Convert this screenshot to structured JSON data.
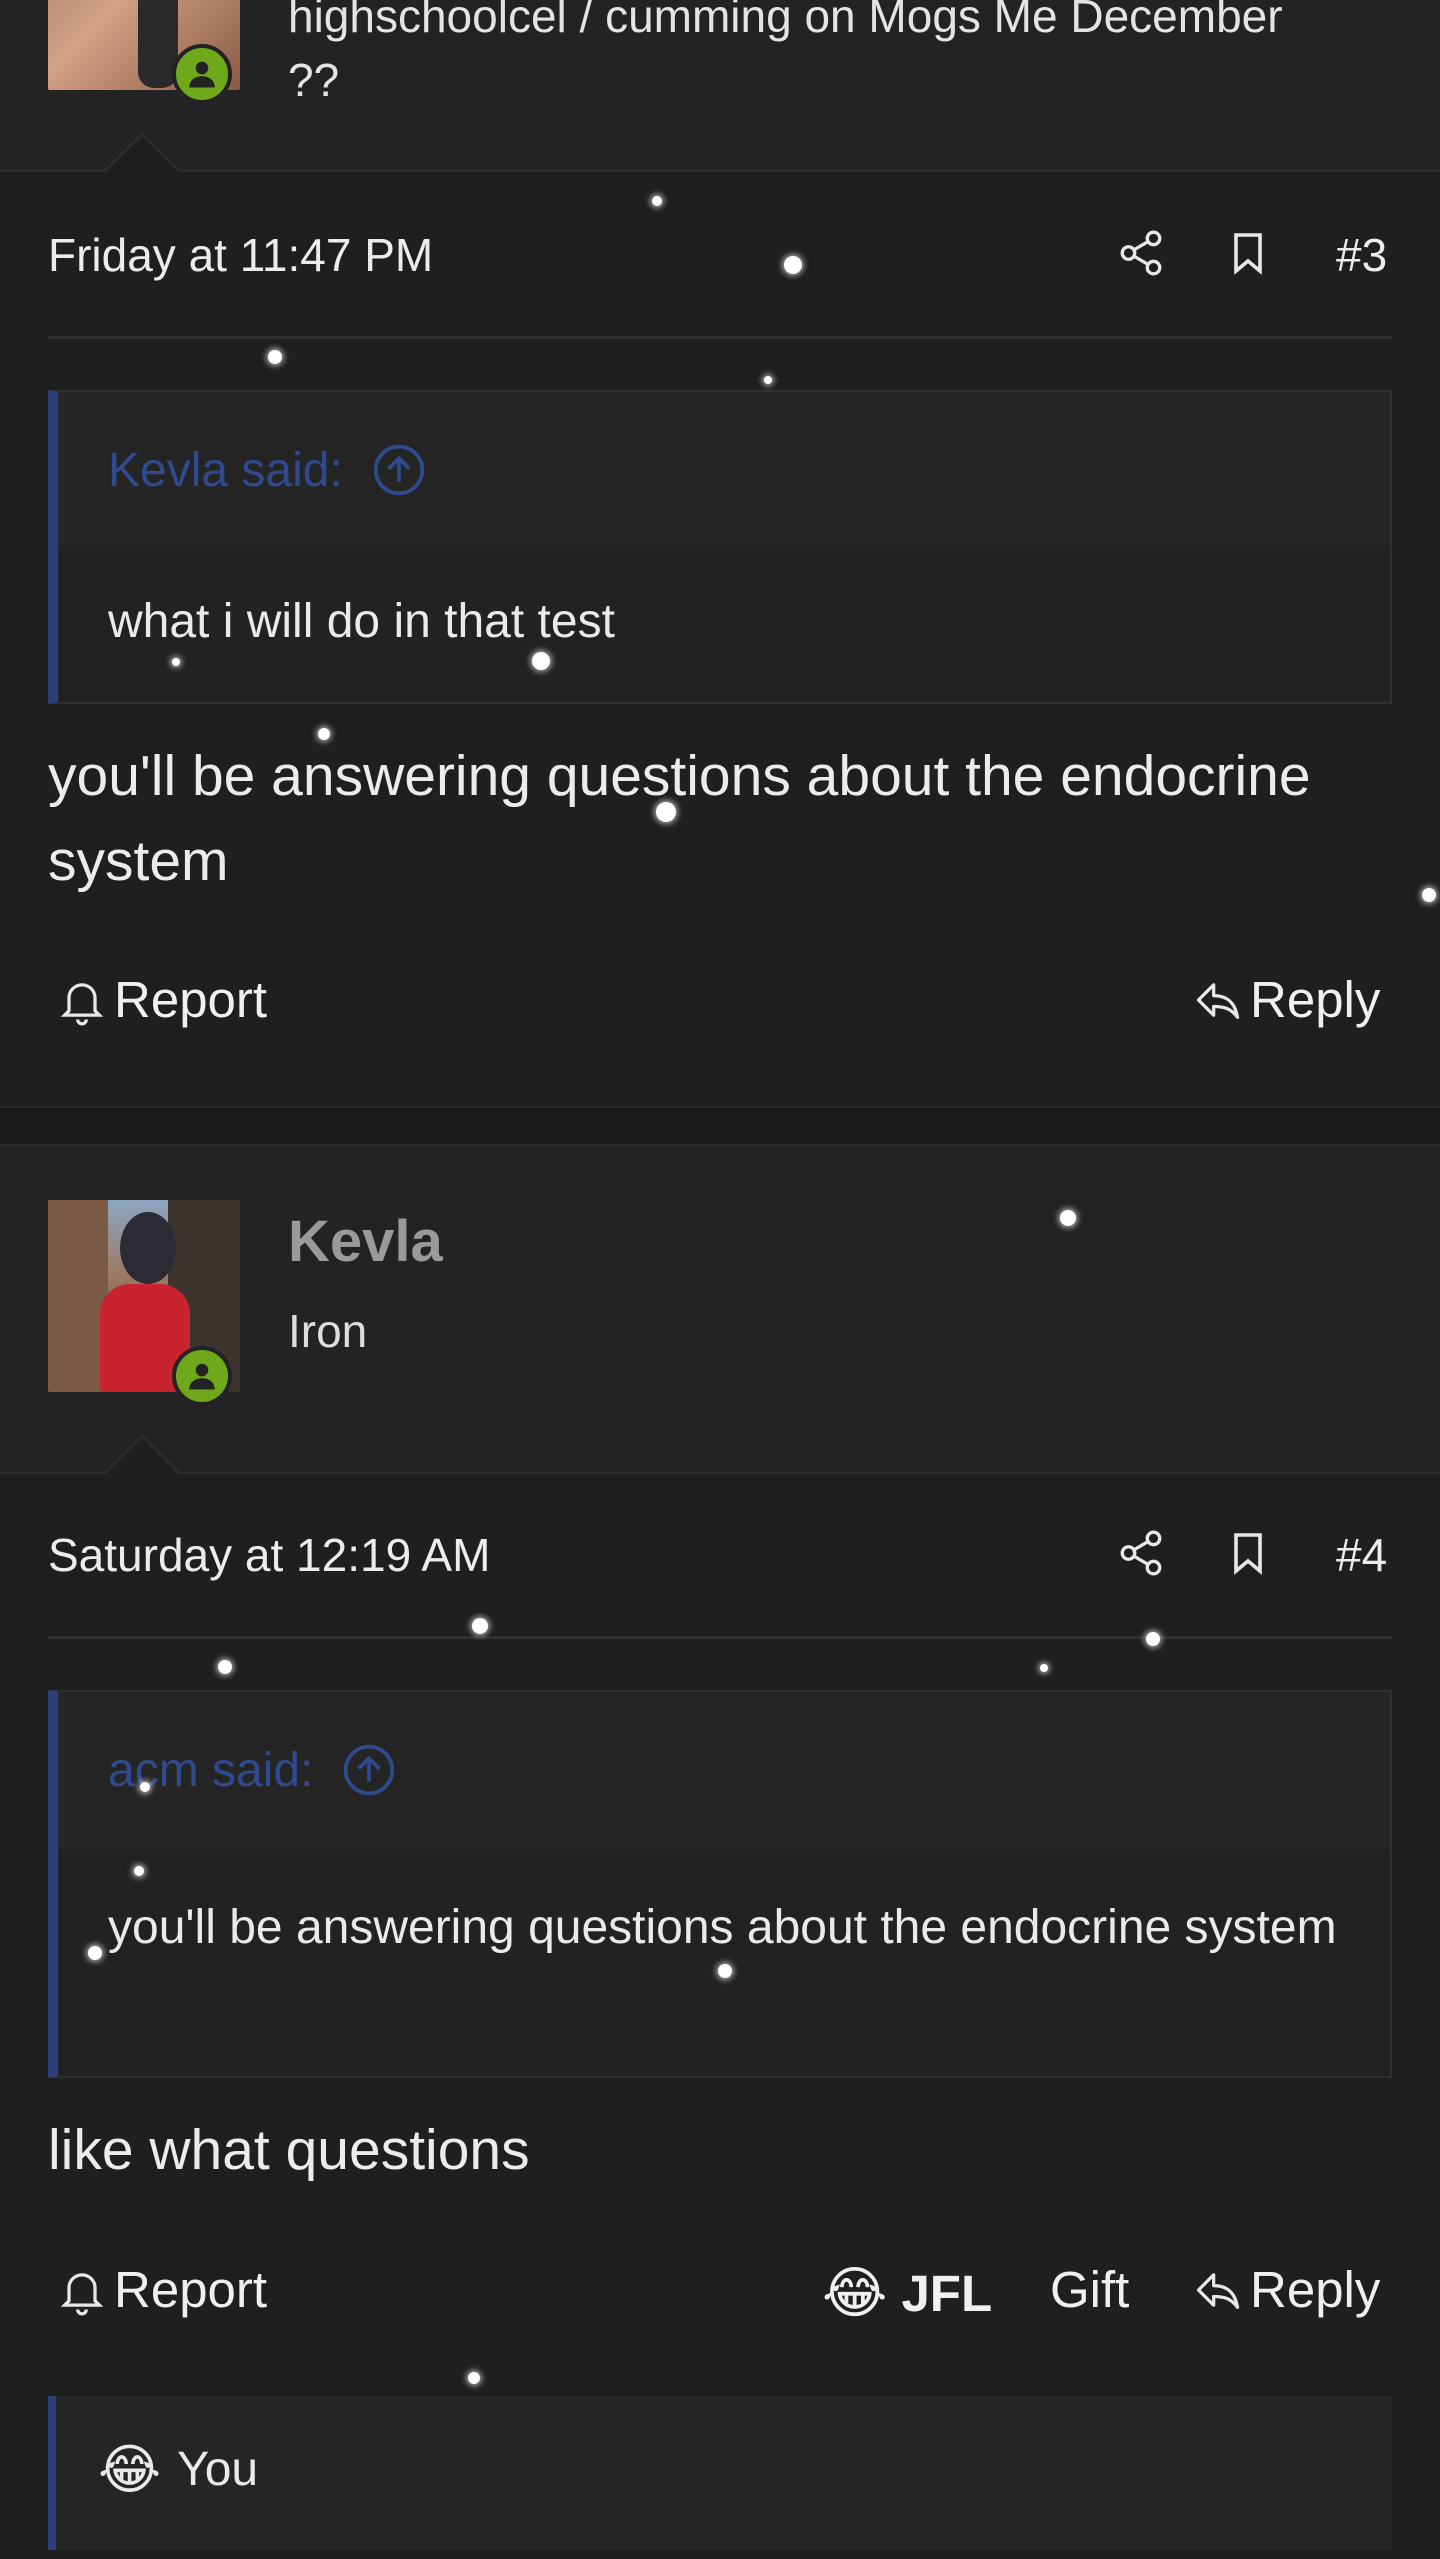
{
  "prev_user": {
    "title_line1": "highschoolcel / cumming on Mogs Me December",
    "title_line2": "??"
  },
  "post3": {
    "timestamp": "Friday at 11:47 PM",
    "number": "#3",
    "quote_author": "Kevla said:",
    "quote_text": "what i will do in that test",
    "body": "you'll be answering questions about the endocrine system",
    "report_label": "Report",
    "reply_label": "Reply"
  },
  "user4": {
    "name": "Kevla",
    "title": "Iron"
  },
  "post4": {
    "timestamp": "Saturday at 12:19 AM",
    "number": "#4",
    "quote_author": "acm said:",
    "quote_text": "you'll be answering questions about the endocrine system",
    "body": "like what questions",
    "report_label": "Report",
    "jfl_label": "JFL",
    "gift_label": "Gift",
    "reply_label": "Reply",
    "reaction_summary": "You"
  },
  "colors": {
    "background": "#1f1f1f",
    "quote_accent": "#2d3f7a",
    "online_badge": "#6fa81a"
  }
}
